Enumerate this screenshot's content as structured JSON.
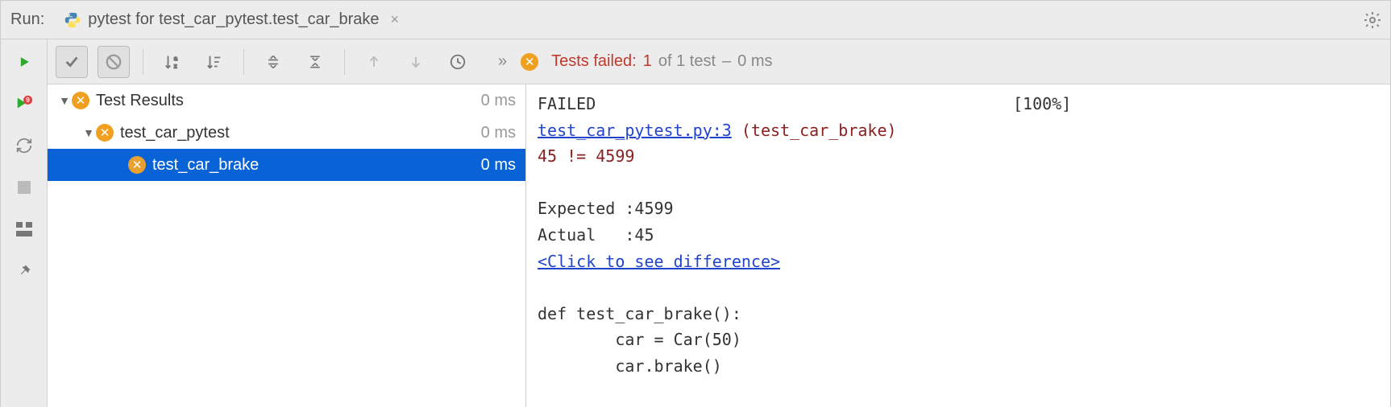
{
  "header": {
    "run_label": "Run:",
    "tab_title": "pytest for test_car_pytest.test_car_brake"
  },
  "status": {
    "label": "Tests failed:",
    "failed": "1",
    "of_text": "of 1 test",
    "time_sep": "–",
    "time": "0 ms"
  },
  "tree": {
    "root": {
      "label": "Test Results",
      "duration": "0 ms"
    },
    "module": {
      "label": "test_car_pytest",
      "duration": "0 ms"
    },
    "test": {
      "label": "test_car_brake",
      "duration": "0 ms"
    }
  },
  "console": {
    "l1a": "FAILED",
    "l1b": "[100%]",
    "l2_link": "test_car_pytest.py:3",
    "l2_rest": " (test_car_brake)",
    "l3": "45 != 4599",
    "l5": "Expected :4599",
    "l6": "Actual   :45",
    "l7": "<Click to see difference>",
    "l9": "def test_car_brake():",
    "l10": "        car = Car(50)",
    "l11": "        car.brake()"
  }
}
